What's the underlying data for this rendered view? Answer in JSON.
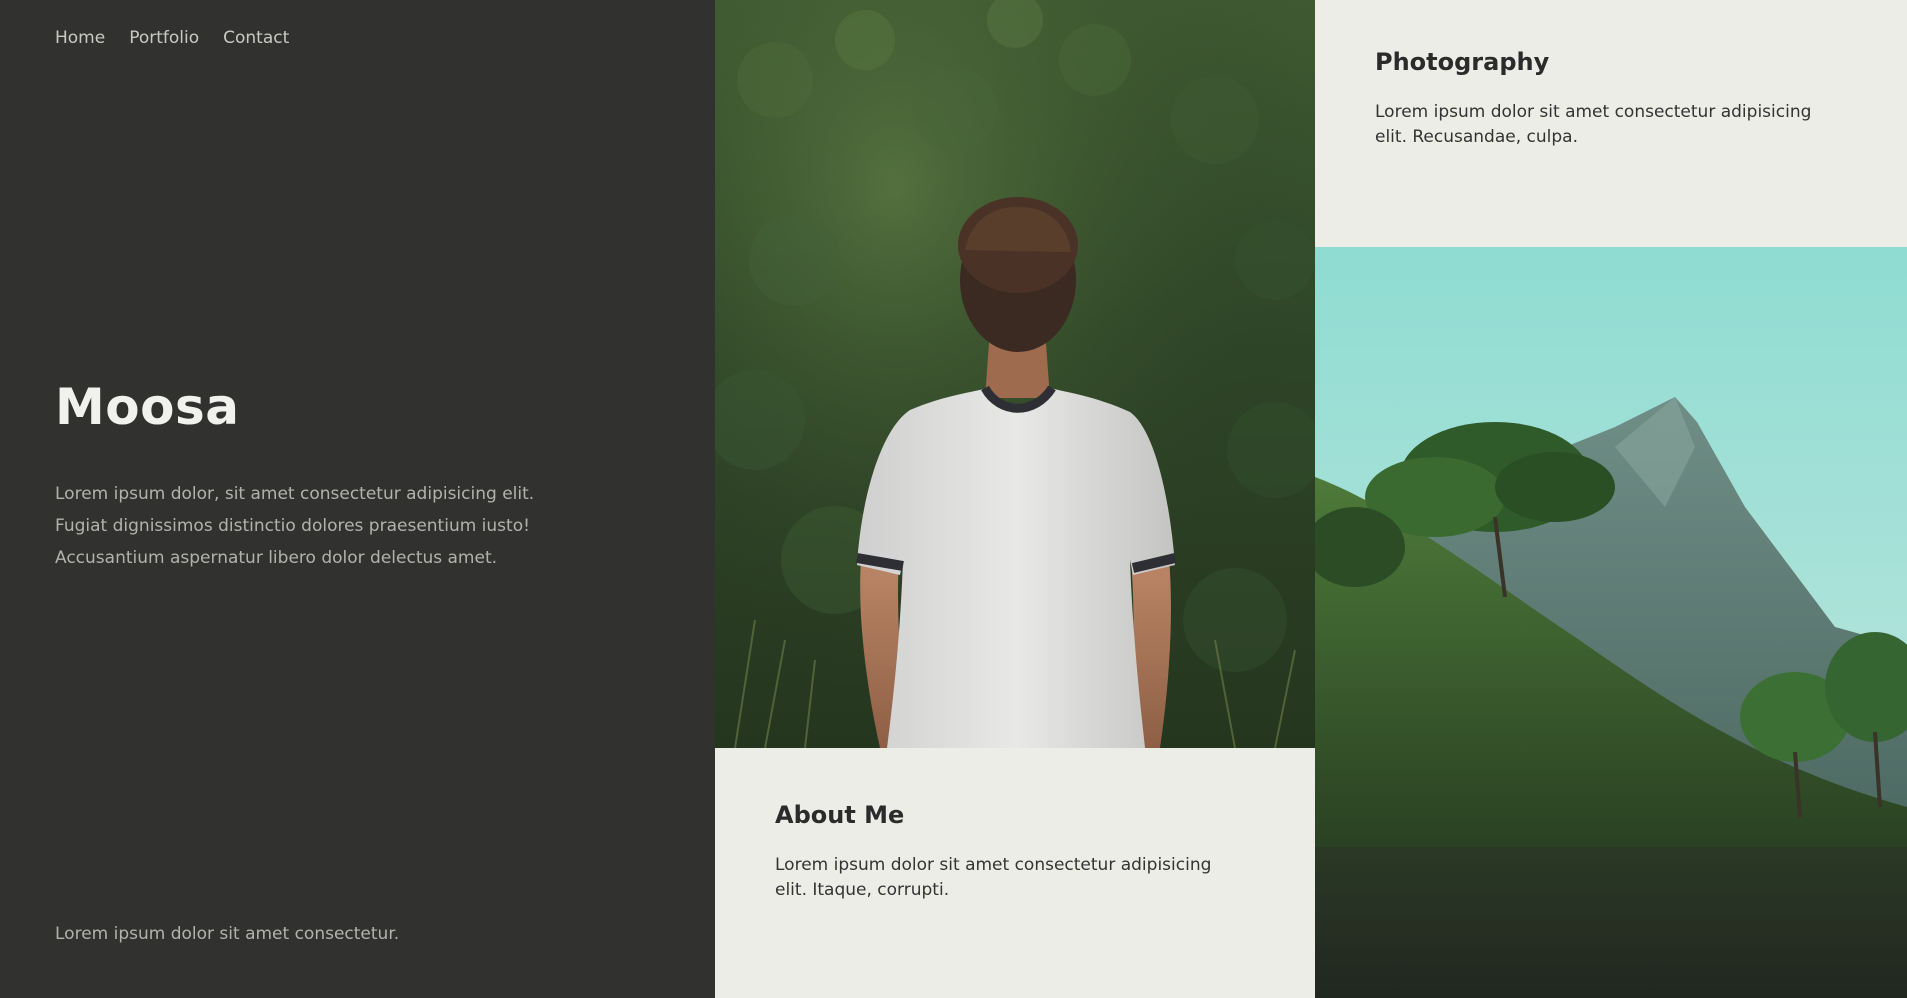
{
  "nav": {
    "items": [
      "Home",
      "Portfolio",
      "Contact"
    ]
  },
  "hero": {
    "title": "Moosa",
    "intro": "Lorem ipsum dolor, sit amet consectetur adipisicing elit. Fugiat dignissimos distinctio dolores praesentium iusto! Accusantium aspernatur libero dolor delectus amet.",
    "footer_note": "Lorem ipsum dolor sit amet consectetur."
  },
  "about": {
    "title": "About Me",
    "text": "Lorem ipsum dolor sit amet consectetur adipisicing elit. Itaque, corrupti."
  },
  "photography": {
    "title": "Photography",
    "text": "Lorem ipsum dolor sit amet consectetur adipisicing elit. Recusandae, culpa."
  },
  "images": {
    "person": "person-in-forest-photo",
    "mountain": "mountain-landscape-photo"
  },
  "colors": {
    "dark_panel": "#313130",
    "light_card": "#edede8",
    "heading_light": "#f1f1ee",
    "text_muted": "#b2b2ad"
  }
}
